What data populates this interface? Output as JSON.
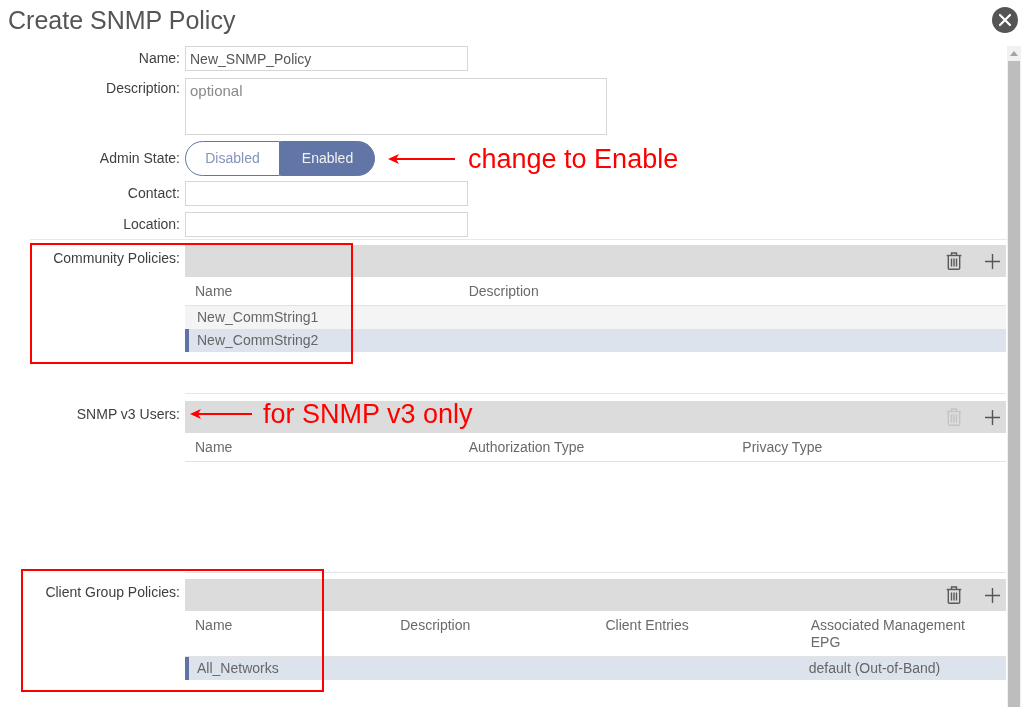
{
  "dialog": {
    "title": "Create SNMP Policy"
  },
  "fields": [
    {
      "kind": "text",
      "label": "Name:",
      "value": "New_SNMP_Policy"
    },
    {
      "kind": "textarea",
      "label": "Description:",
      "placeholder": "optional"
    },
    {
      "kind": "toggle",
      "label": "Admin State:",
      "options": [
        {
          "label": "Disabled",
          "selected": false
        },
        {
          "label": "Enabled",
          "selected": true
        }
      ],
      "note": "change to Enable"
    },
    {
      "kind": "text",
      "label": "Contact:"
    },
    {
      "kind": "text",
      "label": "Location:"
    }
  ],
  "tables": [
    {
      "label": "Community Policies:",
      "highlighted": true,
      "delete_disabled": false,
      "columns": [
        "Name",
        "Description"
      ],
      "rows": [
        {
          "cells": [
            "New_CommString1"
          ],
          "selected": false
        },
        {
          "cells": [
            "New_CommString2"
          ],
          "selected": true
        }
      ]
    },
    {
      "label": "SNMP v3 Users:",
      "note": "for SNMP v3 only",
      "delete_disabled": true,
      "columns": [
        "Name",
        "Authorization Type",
        "Privacy Type"
      ]
    },
    {
      "label": "Client Group Policies:",
      "highlighted": true,
      "delete_disabled": false,
      "columns": [
        "Name",
        "Description",
        "Client Entries",
        "Associated Management EPG"
      ],
      "rows": [
        {
          "cells": [
            "All_Networks",
            null,
            null,
            "default (Out-of-Band)"
          ],
          "selected": true
        }
      ]
    }
  ]
}
